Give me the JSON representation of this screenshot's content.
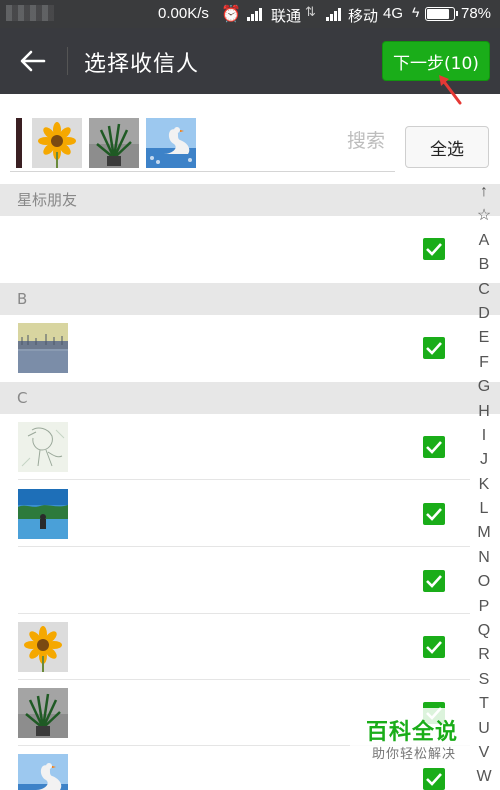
{
  "status_bar": {
    "network_speed": "0.00K/s",
    "carrier_1": "联通",
    "carrier_2": "移动",
    "network_type": "4G",
    "battery_percent": "78%",
    "battery_level": 0.78
  },
  "header": {
    "title": "选择收信人",
    "next_button": "下一步(10)"
  },
  "search": {
    "placeholder": "搜索",
    "select_all": "全选"
  },
  "sections": [
    {
      "label": "星标朋友"
    },
    {
      "label": "B"
    },
    {
      "label": "C"
    }
  ],
  "index_letters": [
    "↑",
    "☆",
    "A",
    "B",
    "C",
    "D",
    "E",
    "F",
    "G",
    "H",
    "I",
    "J",
    "K",
    "L",
    "M",
    "N",
    "O",
    "P",
    "Q",
    "R",
    "S",
    "T",
    "U",
    "V",
    "W"
  ],
  "watermark": {
    "brand": "百科全说",
    "tagline": "助你轻松解决"
  },
  "colors": {
    "accent_green": "#1aad19",
    "title_bar": "#393a3f",
    "status_bar": "#3a3b3d",
    "annotation_red": "#e53935"
  }
}
